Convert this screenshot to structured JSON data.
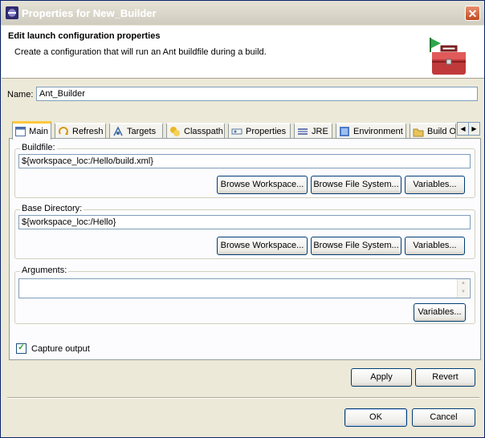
{
  "window": {
    "title": "Properties for New_Builder",
    "close_label": "✕"
  },
  "banner": {
    "title": "Edit launch configuration properties",
    "description": "Create a configuration that will run an Ant buildfile during a build."
  },
  "name": {
    "label": "Name:",
    "value": "Ant_Builder"
  },
  "tabs": [
    {
      "label": "Main",
      "icon": "main-tab-icon"
    },
    {
      "label": "Refresh",
      "icon": "refresh-icon"
    },
    {
      "label": "Targets",
      "icon": "targets-icon"
    },
    {
      "label": "Classpath",
      "icon": "classpath-icon"
    },
    {
      "label": "Properties",
      "icon": "properties-icon"
    },
    {
      "label": "JRE",
      "icon": "jre-icon"
    },
    {
      "label": "Environment",
      "icon": "environment-icon"
    },
    {
      "label": "Build O",
      "icon": "build-options-icon"
    }
  ],
  "main": {
    "buildfile": {
      "label": "Buildfile:",
      "value": "${workspace_loc:/Hello/build.xml}",
      "browse_workspace": "Browse Workspace...",
      "browse_filesystem": "Browse File System...",
      "variables": "Variables..."
    },
    "base_directory": {
      "label": "Base Directory:",
      "value": "${workspace_loc:/Hello}",
      "browse_workspace": "Browse Workspace...",
      "browse_filesystem": "Browse File System...",
      "variables": "Variables..."
    },
    "arguments": {
      "label": "Arguments:",
      "value": "",
      "variables": "Variables..."
    },
    "capture_output": {
      "label": "Capture output",
      "checked": true
    }
  },
  "buttons": {
    "apply": "Apply",
    "revert": "Revert",
    "ok": "OK",
    "cancel": "Cancel"
  },
  "colors": {
    "title_bar": "#cfccbf",
    "dialog_bg": "#ece9d8",
    "active_tab_accent": "#ffc83c",
    "close_button": "#c04a20"
  }
}
